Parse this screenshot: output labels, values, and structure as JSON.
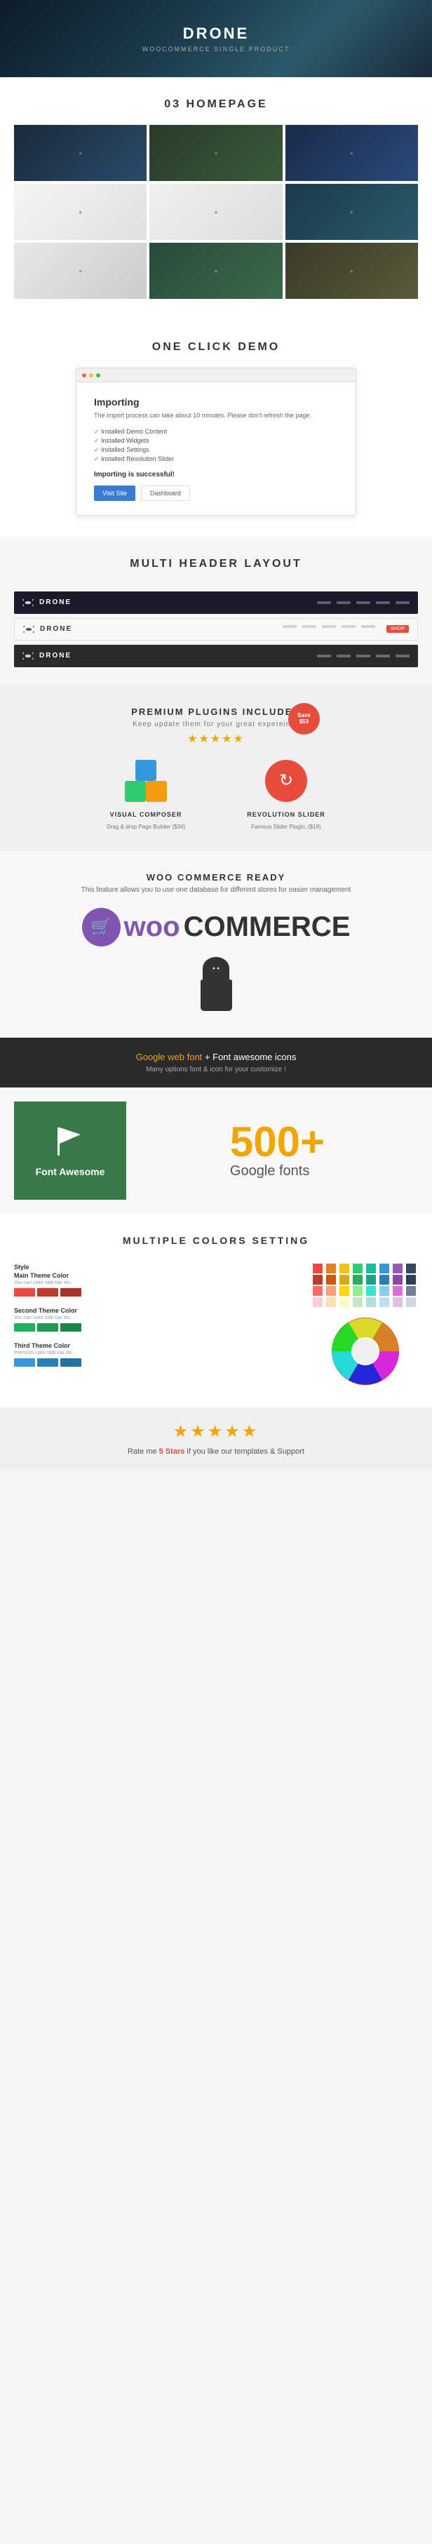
{
  "hero": {
    "logo": "DRONE",
    "subtitle": "WOOCOMMERCE SINGLE PRODUCT",
    "drone_icon": "✈"
  },
  "section_homepage": {
    "label": "03 HOMEPAGE",
    "thumbs": [
      {
        "id": 1,
        "class": "thumb-1"
      },
      {
        "id": 2,
        "class": "thumb-2"
      },
      {
        "id": 3,
        "class": "thumb-3"
      },
      {
        "id": 4,
        "class": "thumb-4"
      },
      {
        "id": 5,
        "class": "thumb-5"
      },
      {
        "id": 6,
        "class": "thumb-6"
      },
      {
        "id": 7,
        "class": "thumb-7"
      },
      {
        "id": 8,
        "class": "thumb-8"
      },
      {
        "id": 9,
        "class": "thumb-9"
      }
    ]
  },
  "section_demo": {
    "title": "ONE CLICK DEMO",
    "window_title": "Importing",
    "window_desc": "The import process can take about 10 minutes. Please don't refresh the page.",
    "steps": [
      "Installed Demo Content",
      "Installed Widgets",
      "Installed Settings",
      "Installed Revolution Slider"
    ],
    "success_msg": "Importing is successful!",
    "btn_visit": "Visit Site",
    "btn_dashboard": "Dashboard"
  },
  "section_header": {
    "title": "MULTI HEADER LAYOUT",
    "headers": [
      {
        "type": "dark",
        "logo": "DRONE"
      },
      {
        "type": "light",
        "logo": "DRONE"
      },
      {
        "type": "colored",
        "logo": "DRONE"
      }
    ]
  },
  "section_plugins": {
    "title": "PREMIUM PLUGINS INCLUDED",
    "subtitle": "Keep update them for your great expereince",
    "save_badge": "Save\n$53",
    "stars": "★★★★★",
    "plugins": [
      {
        "name": "VISUAL COMPOSER",
        "desc": "Drag & drop Page Builder ($34)",
        "icon_type": "vc"
      },
      {
        "name": "REVOLUTION SLIDER",
        "desc": "Famous Slider Plugin, ($19)",
        "icon_type": "rev"
      }
    ]
  },
  "section_woo": {
    "title": "WOO COMMERCE READY",
    "desc": "This feature allows you to use one database for different stores for easier management",
    "logo_woo": "woo",
    "logo_commerce": "COMMERCE"
  },
  "section_font": {
    "title_normal": "Google web font",
    "title_highlight": "+",
    "title_rest": " Font awesome icons",
    "desc": "Many options font & icon for your customize !",
    "font_awesome_label": "Font Awesome",
    "flag_icon": "⚑",
    "google_fonts_number": "500",
    "google_fonts_plus": "+",
    "google_fonts_label": "Google fonts"
  },
  "section_colors": {
    "title": "MULTIPLE COLORS SETTING",
    "options": [
      {
        "label": "Style",
        "sublabel": "Main Theme Color",
        "desc": "You can color side bar etc.",
        "swatches": [
          "#e74c3c",
          "#c0392b",
          "#a93226"
        ]
      },
      {
        "label": "Second Theme Color",
        "sublabel": "",
        "desc": "You can color side bar etc.",
        "swatches": [
          "#27ae60",
          "#229954",
          "#1e8449"
        ]
      },
      {
        "label": "Third Theme Color",
        "sublabel": "",
        "desc": "Premium color side bar etc.",
        "swatches": [
          "#3498db",
          "#2980b9",
          "#2471a3"
        ]
      }
    ],
    "color_cells": [
      "#e74c3c",
      "#e67e22",
      "#f1c40f",
      "#2ecc71",
      "#1abc9c",
      "#3498db",
      "#9b59b6",
      "#34495e",
      "#c0392b",
      "#d35400",
      "#d4ac0d",
      "#27ae60",
      "#17a589",
      "#2980b9",
      "#8e44ad",
      "#2c3e50",
      "#ff6b6b",
      "#ffa07a",
      "#ffd700",
      "#90ee90",
      "#40e0d0",
      "#87ceeb",
      "#da70d6",
      "#708090",
      "#ffcdd2",
      "#ffe0b2",
      "#fff9c4",
      "#c8e6c9",
      "#b2dfdb",
      "#bbdefb",
      "#e1bee7",
      "#cfd8dc"
    ]
  },
  "section_rating": {
    "stars": "★★★★★",
    "text_prefix": "Rate me ",
    "link_text": "5 Stars",
    "text_suffix": " if you like our templates & Support"
  }
}
